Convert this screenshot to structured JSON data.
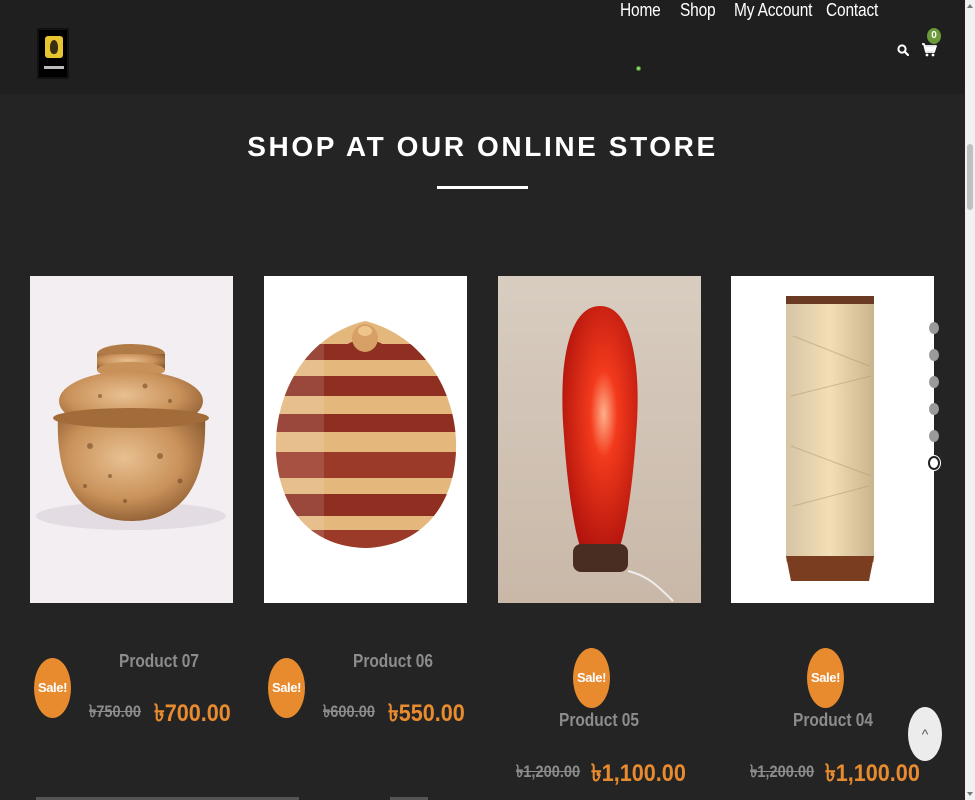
{
  "header": {
    "nav": [
      {
        "label": "Home",
        "active": true
      },
      {
        "label": "Shop"
      },
      {
        "label": "My Account"
      },
      {
        "label": "Contact"
      }
    ],
    "cart_count": "0",
    "icons": [
      "search-icon",
      "cart-icon"
    ]
  },
  "main": {
    "section_title": "SHOP AT OUR ONLINE STORE",
    "products": [
      {
        "name": "Product 07",
        "badge": "Sale!",
        "old_price": "৳750.00",
        "new_price": "৳700.00",
        "image": "clay pot with lid"
      },
      {
        "name": "Product 06",
        "badge": "Sale!",
        "old_price": "৳600.00",
        "new_price": "৳550.00",
        "image": "striped wooden jar"
      },
      {
        "name": "Product 05",
        "badge": "Sale!",
        "old_price": "৳1,200.00",
        "new_price": "৳1,100.00",
        "image": "red table lamp"
      },
      {
        "name": "Product 04",
        "badge": "Sale!",
        "old_price": "৳1,200.00",
        "new_price": "৳1,100.00",
        "image": "square floor lamp"
      }
    ],
    "carousel_dots": 6,
    "carousel_active_index": 5,
    "scroll_top_label": "^"
  },
  "colors": {
    "background": "#242424",
    "header": "#1f1f1f",
    "accent": "#e88b2f",
    "muted": "#8c8c8c",
    "cart_badge": "#6a9a3a"
  }
}
